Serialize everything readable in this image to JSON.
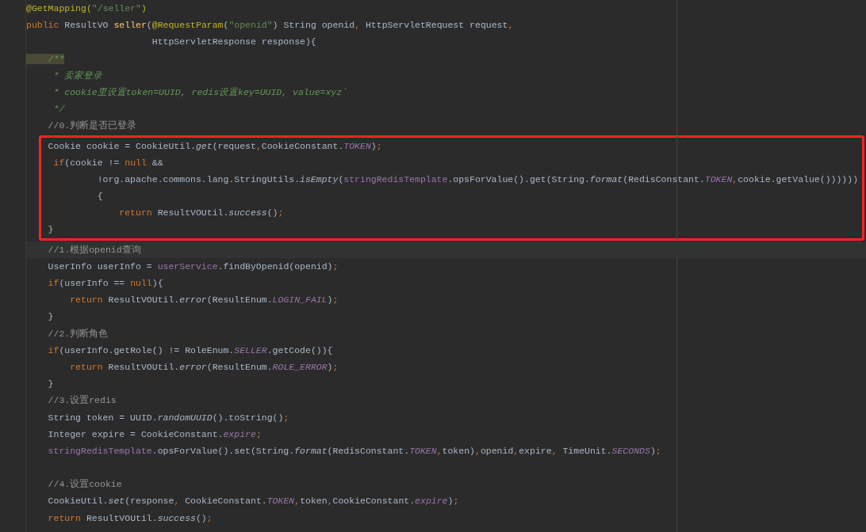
{
  "editor": {
    "blocks": [
      {
        "kind": "plain",
        "lines": [
          {
            "kind": "code",
            "current": false,
            "tokens": [
              {
                "kind": "ann",
                "text": "@GetMapping("
              },
              {
                "kind": "str",
                "text": "\"/seller\""
              },
              {
                "kind": "ann",
                "text": ")"
              }
            ]
          },
          {
            "kind": "code",
            "current": false,
            "tokens": [
              {
                "kind": "kw",
                "text": "public "
              },
              {
                "kind": "plain",
                "text": "ResultVO "
              },
              {
                "kind": "decl",
                "text": "seller"
              },
              {
                "kind": "plain",
                "text": "("
              },
              {
                "kind": "ann",
                "text": "@RequestParam"
              },
              {
                "kind": "plain",
                "text": "("
              },
              {
                "kind": "str",
                "text": "\"openid\""
              },
              {
                "kind": "plain",
                "text": ") String openid"
              },
              {
                "kind": "punct",
                "text": ", "
              },
              {
                "kind": "plain",
                "text": "HttpServletRequest request"
              },
              {
                "kind": "punct",
                "text": ","
              }
            ]
          },
          {
            "kind": "code",
            "current": false,
            "tokens": [
              {
                "kind": "plain",
                "text": "                       HttpServletResponse response){"
              }
            ]
          },
          {
            "kind": "code",
            "current": false,
            "tokens": [
              {
                "kind": "match",
                "text": "    /**"
              }
            ]
          },
          {
            "kind": "code",
            "current": false,
            "tokens": [
              {
                "kind": "doc",
                "text": "     * 卖家登录"
              }
            ]
          },
          {
            "kind": "code",
            "current": false,
            "tokens": [
              {
                "kind": "doc",
                "text": "     * cookie里设置token=UUID, redis设置key=UUID, value=xyz`"
              }
            ]
          },
          {
            "kind": "code",
            "current": false,
            "tokens": [
              {
                "kind": "doc",
                "text": "     */"
              }
            ]
          },
          {
            "kind": "code",
            "current": false,
            "tokens": [
              {
                "kind": "cmt",
                "text": "    //0.判断是否已登录"
              }
            ]
          }
        ]
      },
      {
        "kind": "boxed",
        "lines": [
          {
            "kind": "code",
            "current": false,
            "tokens": [
              {
                "kind": "plain",
                "text": "    Cookie cookie = CookieUtil."
              },
              {
                "kind": "sm",
                "text": "get"
              },
              {
                "kind": "plain",
                "text": "(request"
              },
              {
                "kind": "punct",
                "text": ","
              },
              {
                "kind": "plain",
                "text": "CookieConstant."
              },
              {
                "kind": "sf",
                "text": "TOKEN"
              },
              {
                "kind": "plain",
                "text": ")"
              },
              {
                "kind": "punct",
                "text": ";"
              }
            ]
          },
          {
            "kind": "code",
            "current": false,
            "tokens": [
              {
                "kind": "kw",
                "text": "     if"
              },
              {
                "kind": "plain",
                "text": "(cookie != "
              },
              {
                "kind": "kw",
                "text": "null"
              },
              {
                "kind": "plain",
                "text": " &&"
              }
            ]
          },
          {
            "kind": "code",
            "current": false,
            "tokens": [
              {
                "kind": "plain",
                "text": "             !org.apache.commons.lang.StringUtils."
              },
              {
                "kind": "sm",
                "text": "isEmpty"
              },
              {
                "kind": "plain",
                "text": "("
              },
              {
                "kind": "field",
                "text": "stringRedisTemplate"
              },
              {
                "kind": "plain",
                "text": ".opsForValue().get(String."
              },
              {
                "kind": "sm",
                "text": "format"
              },
              {
                "kind": "plain",
                "text": "(RedisConstant."
              },
              {
                "kind": "sf",
                "text": "TOKEN"
              },
              {
                "kind": "punct",
                "text": ","
              },
              {
                "kind": "plain",
                "text": "cookie.getValue())))))"
              }
            ]
          },
          {
            "kind": "code",
            "current": false,
            "tokens": [
              {
                "kind": "plain",
                "text": "             {"
              }
            ]
          },
          {
            "kind": "code",
            "current": false,
            "tokens": [
              {
                "kind": "kw",
                "text": "                 return "
              },
              {
                "kind": "plain",
                "text": "ResultVOUtil."
              },
              {
                "kind": "sm",
                "text": "success"
              },
              {
                "kind": "plain",
                "text": "()"
              },
              {
                "kind": "punct",
                "text": ";"
              }
            ]
          },
          {
            "kind": "code",
            "current": false,
            "tokens": [
              {
                "kind": "plain",
                "text": "    }"
              }
            ]
          }
        ]
      },
      {
        "kind": "plain",
        "lines": [
          {
            "kind": "code",
            "current": true,
            "tokens": [
              {
                "kind": "cmt",
                "text": "    //1.根据openid查询"
              }
            ]
          },
          {
            "kind": "code",
            "current": false,
            "tokens": [
              {
                "kind": "plain",
                "text": "    UserInfo userInfo = "
              },
              {
                "kind": "field",
                "text": "userService"
              },
              {
                "kind": "plain",
                "text": ".findByOpenid(openid)"
              },
              {
                "kind": "punct",
                "text": ";"
              }
            ]
          },
          {
            "kind": "code",
            "current": false,
            "tokens": [
              {
                "kind": "kw",
                "text": "    if"
              },
              {
                "kind": "plain",
                "text": "(userInfo == "
              },
              {
                "kind": "kw",
                "text": "null"
              },
              {
                "kind": "plain",
                "text": "){"
              }
            ]
          },
          {
            "kind": "code",
            "current": false,
            "tokens": [
              {
                "kind": "kw",
                "text": "        return "
              },
              {
                "kind": "plain",
                "text": "ResultVOUtil."
              },
              {
                "kind": "sm",
                "text": "error"
              },
              {
                "kind": "plain",
                "text": "(ResultEnum."
              },
              {
                "kind": "sf",
                "text": "LOGIN_FAIL"
              },
              {
                "kind": "plain",
                "text": ")"
              },
              {
                "kind": "punct",
                "text": ";"
              }
            ]
          },
          {
            "kind": "code",
            "current": false,
            "tokens": [
              {
                "kind": "plain",
                "text": "    }"
              }
            ]
          },
          {
            "kind": "code",
            "current": false,
            "tokens": [
              {
                "kind": "cmt",
                "text": "    //2.判断角色"
              }
            ]
          },
          {
            "kind": "code",
            "current": false,
            "tokens": [
              {
                "kind": "kw",
                "text": "    if"
              },
              {
                "kind": "plain",
                "text": "(userInfo.getRole() != RoleEnum."
              },
              {
                "kind": "sf",
                "text": "SELLER"
              },
              {
                "kind": "plain",
                "text": ".getCode()){"
              }
            ]
          },
          {
            "kind": "code",
            "current": false,
            "tokens": [
              {
                "kind": "kw",
                "text": "        return "
              },
              {
                "kind": "plain",
                "text": "ResultVOUtil."
              },
              {
                "kind": "sm",
                "text": "error"
              },
              {
                "kind": "plain",
                "text": "(ResultEnum."
              },
              {
                "kind": "sf",
                "text": "ROLE_ERROR"
              },
              {
                "kind": "plain",
                "text": ")"
              },
              {
                "kind": "punct",
                "text": ";"
              }
            ]
          },
          {
            "kind": "code",
            "current": false,
            "tokens": [
              {
                "kind": "plain",
                "text": "    }"
              }
            ]
          },
          {
            "kind": "code",
            "current": false,
            "tokens": [
              {
                "kind": "cmt",
                "text": "    //3.设置redis"
              }
            ]
          },
          {
            "kind": "code",
            "current": false,
            "tokens": [
              {
                "kind": "plain",
                "text": "    String token = UUID."
              },
              {
                "kind": "sm",
                "text": "randomUUID"
              },
              {
                "kind": "plain",
                "text": "().toString()"
              },
              {
                "kind": "punct",
                "text": ";"
              }
            ]
          },
          {
            "kind": "code",
            "current": false,
            "tokens": [
              {
                "kind": "plain",
                "text": "    Integer expire = CookieConstant."
              },
              {
                "kind": "sf",
                "text": "expire"
              },
              {
                "kind": "punct",
                "text": ";"
              }
            ]
          },
          {
            "kind": "code",
            "current": false,
            "tokens": [
              {
                "kind": "field",
                "text": "    stringRedisTemplate"
              },
              {
                "kind": "plain",
                "text": ".opsForValue().set(String."
              },
              {
                "kind": "sm",
                "text": "format"
              },
              {
                "kind": "plain",
                "text": "(RedisConstant."
              },
              {
                "kind": "sf",
                "text": "TOKEN"
              },
              {
                "kind": "punct",
                "text": ","
              },
              {
                "kind": "plain",
                "text": "token)"
              },
              {
                "kind": "punct",
                "text": ","
              },
              {
                "kind": "plain",
                "text": "openid"
              },
              {
                "kind": "punct",
                "text": ","
              },
              {
                "kind": "plain",
                "text": "expire"
              },
              {
                "kind": "punct",
                "text": ", "
              },
              {
                "kind": "plain",
                "text": "TimeUnit."
              },
              {
                "kind": "sf",
                "text": "SECONDS"
              },
              {
                "kind": "plain",
                "text": ")"
              },
              {
                "kind": "punct",
                "text": ";"
              }
            ]
          },
          {
            "kind": "blank"
          },
          {
            "kind": "code",
            "current": false,
            "tokens": [
              {
                "kind": "cmt",
                "text": "    //4.设置cookie"
              }
            ]
          },
          {
            "kind": "code",
            "current": false,
            "tokens": [
              {
                "kind": "plain",
                "text": "    CookieUtil."
              },
              {
                "kind": "sm",
                "text": "set"
              },
              {
                "kind": "plain",
                "text": "(response"
              },
              {
                "kind": "punct",
                "text": ", "
              },
              {
                "kind": "plain",
                "text": "CookieConstant."
              },
              {
                "kind": "sf",
                "text": "TOKEN"
              },
              {
                "kind": "punct",
                "text": ","
              },
              {
                "kind": "plain",
                "text": "token"
              },
              {
                "kind": "punct",
                "text": ","
              },
              {
                "kind": "plain",
                "text": "CookieConstant."
              },
              {
                "kind": "sf",
                "text": "expire"
              },
              {
                "kind": "plain",
                "text": ")"
              },
              {
                "kind": "punct",
                "text": ";"
              }
            ]
          },
          {
            "kind": "code",
            "current": false,
            "tokens": [
              {
                "kind": "kw",
                "text": "    return "
              },
              {
                "kind": "plain",
                "text": "ResultVOUtil."
              },
              {
                "kind": "sm",
                "text": "success"
              },
              {
                "kind": "plain",
                "text": "()"
              },
              {
                "kind": "punct",
                "text": ";"
              }
            ]
          }
        ]
      }
    ]
  }
}
